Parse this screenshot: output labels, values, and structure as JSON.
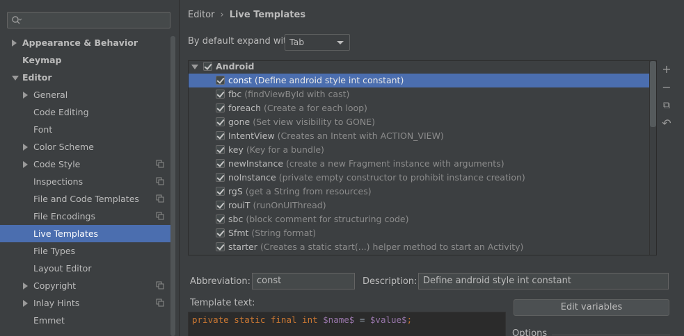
{
  "search": {
    "placeholder": ""
  },
  "sidebar": {
    "items": [
      {
        "label": "Appearance & Behavior",
        "level": 0,
        "arrow": "right",
        "bold": true,
        "copy": false,
        "selected": false
      },
      {
        "label": "Keymap",
        "level": 0,
        "arrow": "none",
        "bold": true,
        "copy": false,
        "selected": false
      },
      {
        "label": "Editor",
        "level": 0,
        "arrow": "down",
        "bold": true,
        "copy": false,
        "selected": false
      },
      {
        "label": "General",
        "level": 1,
        "arrow": "right",
        "bold": false,
        "copy": false,
        "selected": false
      },
      {
        "label": "Code Editing",
        "level": 1,
        "arrow": "none",
        "bold": false,
        "copy": false,
        "selected": false
      },
      {
        "label": "Font",
        "level": 1,
        "arrow": "none",
        "bold": false,
        "copy": false,
        "selected": false
      },
      {
        "label": "Color Scheme",
        "level": 1,
        "arrow": "right",
        "bold": false,
        "copy": false,
        "selected": false
      },
      {
        "label": "Code Style",
        "level": 1,
        "arrow": "right",
        "bold": false,
        "copy": true,
        "selected": false
      },
      {
        "label": "Inspections",
        "level": 1,
        "arrow": "none",
        "bold": false,
        "copy": true,
        "selected": false
      },
      {
        "label": "File and Code Templates",
        "level": 1,
        "arrow": "none",
        "bold": false,
        "copy": true,
        "selected": false
      },
      {
        "label": "File Encodings",
        "level": 1,
        "arrow": "none",
        "bold": false,
        "copy": true,
        "selected": false
      },
      {
        "label": "Live Templates",
        "level": 1,
        "arrow": "none",
        "bold": false,
        "copy": false,
        "selected": true
      },
      {
        "label": "File Types",
        "level": 1,
        "arrow": "none",
        "bold": false,
        "copy": false,
        "selected": false
      },
      {
        "label": "Layout Editor",
        "level": 1,
        "arrow": "none",
        "bold": false,
        "copy": false,
        "selected": false
      },
      {
        "label": "Copyright",
        "level": 1,
        "arrow": "right",
        "bold": false,
        "copy": true,
        "selected": false
      },
      {
        "label": "Inlay Hints",
        "level": 1,
        "arrow": "right",
        "bold": false,
        "copy": true,
        "selected": false
      },
      {
        "label": "Emmet",
        "level": 1,
        "arrow": "none",
        "bold": false,
        "copy": false,
        "selected": false
      }
    ]
  },
  "breadcrumb": {
    "parent": "Editor",
    "separator": "›",
    "current": "Live Templates"
  },
  "expand": {
    "label": "By default expand with",
    "value": "Tab"
  },
  "templates": {
    "group": "Android",
    "items": [
      {
        "abbr": "const",
        "desc": "(Define android style int constant)",
        "selected": true
      },
      {
        "abbr": "fbc",
        "desc": "(findViewById with cast)",
        "selected": false
      },
      {
        "abbr": "foreach",
        "desc": "(Create a for each loop)",
        "selected": false
      },
      {
        "abbr": "gone",
        "desc": "(Set view visibility to GONE)",
        "selected": false
      },
      {
        "abbr": "IntentView",
        "desc": "(Creates an Intent with ACTION_VIEW)",
        "selected": false
      },
      {
        "abbr": "key",
        "desc": "(Key for a bundle)",
        "selected": false
      },
      {
        "abbr": "newInstance",
        "desc": "(create a new Fragment instance with arguments)",
        "selected": false
      },
      {
        "abbr": "noInstance",
        "desc": "(private empty constructor to prohibit instance creation)",
        "selected": false
      },
      {
        "abbr": "rgS",
        "desc": "(get a String from resources)",
        "selected": false
      },
      {
        "abbr": "rouiT",
        "desc": "(runOnUIThread)",
        "selected": false
      },
      {
        "abbr": "sbc",
        "desc": "(block comment for structuring code)",
        "selected": false
      },
      {
        "abbr": "Sfmt",
        "desc": "(String format)",
        "selected": false
      },
      {
        "abbr": "starter",
        "desc": "(Creates a static start(...) helper method to start an Activity)",
        "selected": false
      }
    ]
  },
  "tools": {
    "add": "+",
    "remove": "−",
    "copy": "⧉",
    "revert": "↶"
  },
  "form": {
    "abbr_label": "Abbreviation:",
    "abbr_value": "const",
    "desc_label": "Description:",
    "desc_value": "Define android style int constant",
    "template_text_label": "Template text:",
    "edit_variables": "Edit variables",
    "options_label": "Options"
  },
  "code": {
    "kw1": "private static final int",
    "var1": "$name$",
    "op": " = ",
    "var2": "$value$",
    "end": ";"
  },
  "colors": {
    "selection": "#4b6eaf",
    "background": "#3c3f41",
    "keyword": "#cc7832",
    "variable": "#9876aa"
  }
}
